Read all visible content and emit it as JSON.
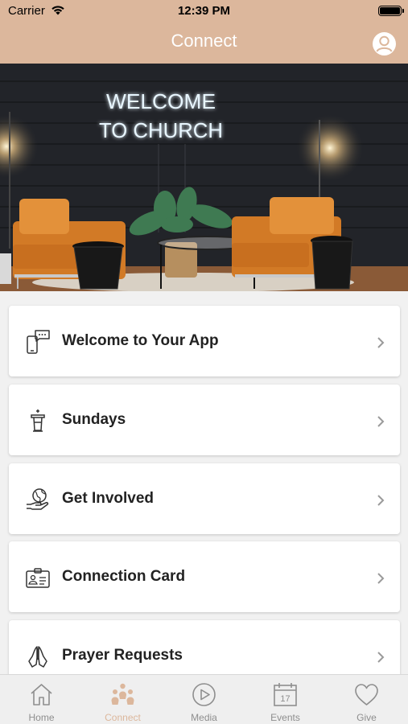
{
  "status_bar": {
    "carrier": "Carrier",
    "time": "12:39 PM"
  },
  "header": {
    "title": "Connect"
  },
  "hero": {
    "sign_line1": "WELCOME",
    "sign_line2": "TO CHURCH"
  },
  "menu": [
    {
      "label": "Welcome to Your App",
      "icon": "phone-chat-icon"
    },
    {
      "label": "Sundays",
      "icon": "pulpit-icon"
    },
    {
      "label": "Get Involved",
      "icon": "globe-hand-icon"
    },
    {
      "label": "Connection Card",
      "icon": "id-card-icon"
    },
    {
      "label": "Prayer Requests",
      "icon": "praying-hands-icon"
    }
  ],
  "tabs": [
    {
      "label": "Home",
      "icon": "home-icon",
      "active": false
    },
    {
      "label": "Connect",
      "icon": "people-icon",
      "active": true
    },
    {
      "label": "Media",
      "icon": "play-icon",
      "active": false
    },
    {
      "label": "Events",
      "icon": "calendar-icon",
      "active": false,
      "calendar_day": "17"
    },
    {
      "label": "Give",
      "icon": "heart-icon",
      "active": false
    }
  ],
  "colors": {
    "accent": "#dcb79c",
    "tab_inactive": "#8e8e8e",
    "card_text": "#222222"
  }
}
